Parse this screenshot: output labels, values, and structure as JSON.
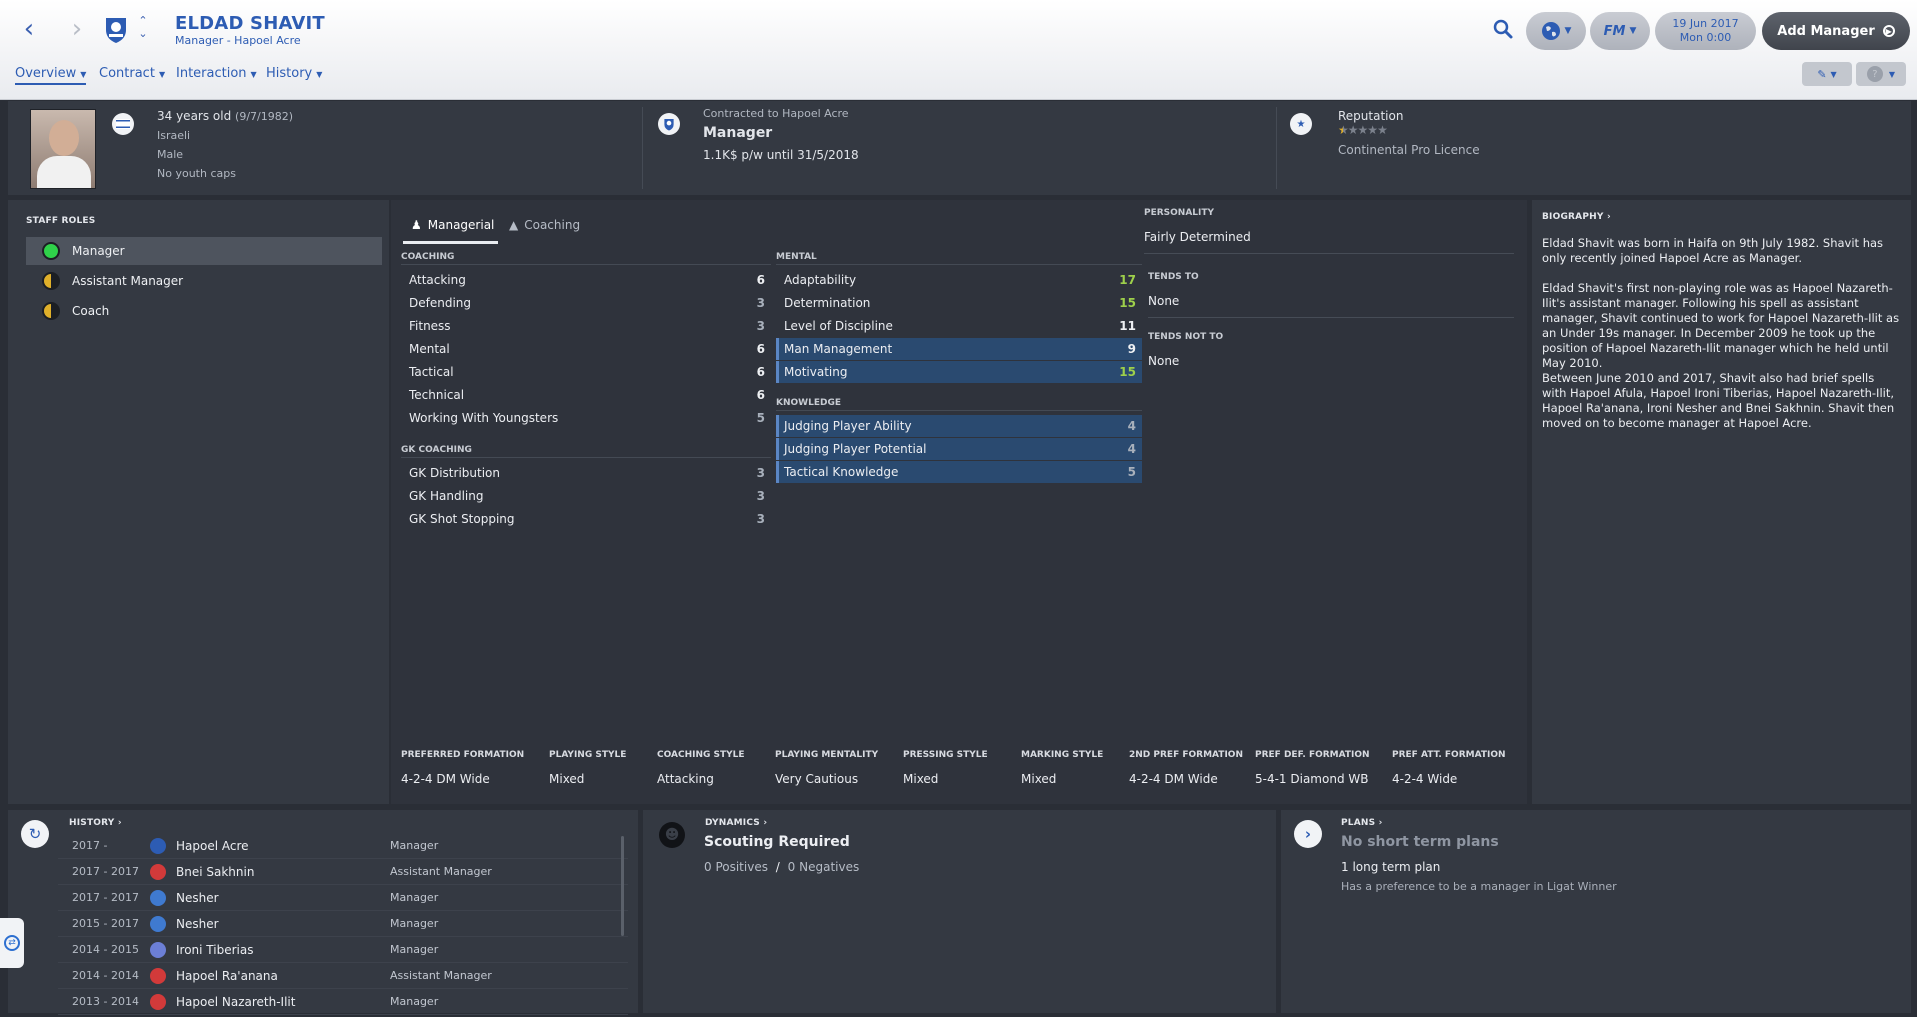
{
  "header": {
    "name": "ELDAD SHAVIT",
    "subtitle": "Manager - Hapoel Acre",
    "tabs": [
      {
        "label": "Overview"
      },
      {
        "label": "Contract"
      },
      {
        "label": "Interaction"
      },
      {
        "label": "History"
      }
    ],
    "date_line1": "19 Jun 2017",
    "date_line2": "Mon 0:00",
    "fm_label": "FM",
    "add_manager": "Add Manager"
  },
  "info": {
    "age": "34 years old",
    "dob": "(9/7/1982)",
    "nationality": "Israeli",
    "gender": "Male",
    "youth_caps": "No youth caps",
    "contract_to": "Contracted to Hapoel Acre",
    "role": "Manager",
    "wage": "1.1K$ p/w until 31/5/2018",
    "reputation_label": "Reputation",
    "reputation_stars": 0.5,
    "licence": "Continental Pro Licence"
  },
  "staff_roles": {
    "title": "STAFF ROLES",
    "items": [
      {
        "label": "Manager",
        "status": "green"
      },
      {
        "label": "Assistant Manager",
        "status": "half"
      },
      {
        "label": "Coach",
        "status": "half"
      }
    ]
  },
  "attr_tabs": {
    "managerial": "Managerial",
    "coaching": "Coaching"
  },
  "coaching": {
    "title": "COACHING",
    "items": [
      {
        "name": "Attacking",
        "value": "6"
      },
      {
        "name": "Defending",
        "value": "3"
      },
      {
        "name": "Fitness",
        "value": "3"
      },
      {
        "name": "Mental",
        "value": "6"
      },
      {
        "name": "Tactical",
        "value": "6"
      },
      {
        "name": "Technical",
        "value": "6"
      },
      {
        "name": "Working With Youngsters",
        "value": "5"
      }
    ]
  },
  "gk_coaching": {
    "title": "GK COACHING",
    "items": [
      {
        "name": "GK Distribution",
        "value": "3"
      },
      {
        "name": "GK Handling",
        "value": "3"
      },
      {
        "name": "GK Shot Stopping",
        "value": "3"
      }
    ]
  },
  "mental": {
    "title": "MENTAL",
    "items": [
      {
        "name": "Adaptability",
        "value": "17"
      },
      {
        "name": "Determination",
        "value": "15"
      },
      {
        "name": "Level of Discipline",
        "value": "11"
      },
      {
        "name": "Man Management",
        "value": "9"
      },
      {
        "name": "Motivating",
        "value": "15"
      }
    ]
  },
  "knowledge": {
    "title": "KNOWLEDGE",
    "items": [
      {
        "name": "Judging Player Ability",
        "value": "4"
      },
      {
        "name": "Judging Player Potential",
        "value": "4"
      },
      {
        "name": "Tactical Knowledge",
        "value": "5"
      }
    ]
  },
  "personality": {
    "title": "PERSONALITY",
    "value": "Fairly Determined",
    "tends_to_title": "TENDS TO",
    "tends_to": "None",
    "tends_not_to_title": "TENDS NOT TO",
    "tends_not_to": "None"
  },
  "styles": [
    {
      "label": "PREFERRED FORMATION",
      "value": "4-2-4 DM Wide"
    },
    {
      "label": "PLAYING STYLE",
      "value": "Mixed"
    },
    {
      "label": "COACHING STYLE",
      "value": "Attacking"
    },
    {
      "label": "PLAYING MENTALITY",
      "value": "Very Cautious"
    },
    {
      "label": "PRESSING STYLE",
      "value": "Mixed"
    },
    {
      "label": "MARKING STYLE",
      "value": "Mixed"
    },
    {
      "label": "2ND PREF FORMATION",
      "value": "4-2-4 DM Wide"
    },
    {
      "label": "PREF DEF. FORMATION",
      "value": "5-4-1 Diamond WB"
    },
    {
      "label": "PREF ATT. FORMATION",
      "value": "4-2-4 Wide"
    }
  ],
  "biography": {
    "title": "BIOGRAPHY",
    "p1": "Eldad Shavit was born in Haifa on 9th July 1982. Shavit has only recently joined Hapoel Acre as Manager.",
    "p2": "Eldad Shavit's first non-playing role was as Hapoel Nazareth-Ilit's assistant manager. Following his spell as assistant manager, Shavit continued to work for Hapoel Nazareth-Ilit as an Under 19s manager. In December 2009 he took up the position of Hapoel Nazareth-Ilit manager which he held until May 2010.",
    "p3": "Between June 2010 and 2017, Shavit also had brief spells with Hapoel Afula, Hapoel Ironi Tiberias, Hapoel Nazareth-Ilit, Hapoel Ra'anana, Ironi Nesher and Bnei Sakhnin. Shavit then moved on to become manager at Hapoel Acre."
  },
  "history": {
    "title": "HISTORY",
    "rows": [
      {
        "years": "2017 -",
        "club": "Hapoel Acre",
        "role": "Manager",
        "crest_color": "#2d5cb3"
      },
      {
        "years": "2017 - 2017",
        "club": "Bnei Sakhnin",
        "role": "Assistant Manager",
        "crest_color": "#d23a3a"
      },
      {
        "years": "2017 - 2017",
        "club": "Nesher",
        "role": "Manager",
        "crest_color": "#3f7ad0"
      },
      {
        "years": "2015 - 2017",
        "club": "Nesher",
        "role": "Manager",
        "crest_color": "#3f7ad0"
      },
      {
        "years": "2014 - 2015",
        "club": "Ironi Tiberias",
        "role": "Manager",
        "crest_color": "#6c7fd6"
      },
      {
        "years": "2014 - 2014",
        "club": "Hapoel Ra'anana",
        "role": "Assistant Manager",
        "crest_color": "#d23a3a"
      },
      {
        "years": "2013 - 2014",
        "club": "Hapoel Nazareth-Ilit",
        "role": "Manager",
        "crest_color": "#d23a3a"
      }
    ]
  },
  "dynamics": {
    "title": "DYNAMICS",
    "status": "Scouting Required",
    "positives": "0 Positives",
    "sep": "/",
    "negatives": "0 Negatives"
  },
  "plans": {
    "title": "PLANS",
    "short_term": "No short term plans",
    "long_term": "1 long term plan",
    "preference": "Has a preference to be a manager in Ligat Winner"
  },
  "colors": {
    "accent": "#2d5cb3",
    "highlight_row": "#2a4a70",
    "high_value": "#9ed04b"
  }
}
